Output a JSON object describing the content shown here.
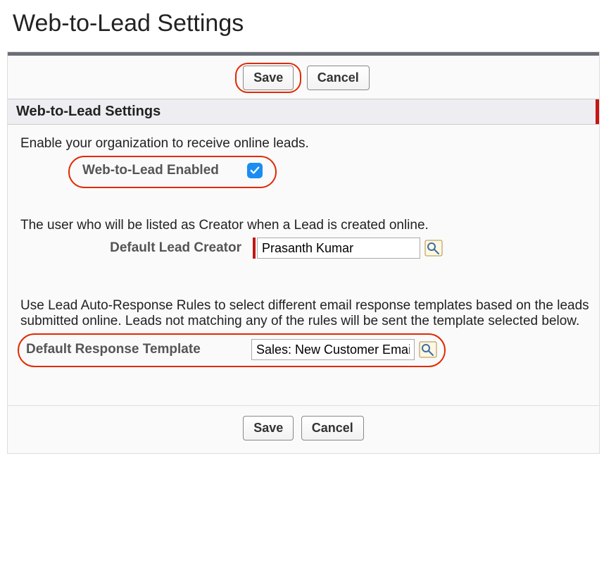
{
  "page": {
    "title": "Web-to-Lead Settings"
  },
  "buttons": {
    "save": "Save",
    "cancel": "Cancel"
  },
  "section": {
    "header": "Web-to-Lead Settings"
  },
  "enable": {
    "desc": "Enable your organization to receive online leads.",
    "label": "Web-to-Lead Enabled",
    "checked": true
  },
  "creator": {
    "desc": "The user who will be listed as Creator when a Lead is created online.",
    "label": "Default Lead Creator",
    "value": "Prasanth Kumar"
  },
  "response": {
    "desc": "Use Lead Auto-Response Rules to select different email response templates based on the leads submitted online. Leads not matching any of the rules will be sent the template selected below.",
    "label": "Default Response Template",
    "value": "Sales: New Customer Email"
  }
}
